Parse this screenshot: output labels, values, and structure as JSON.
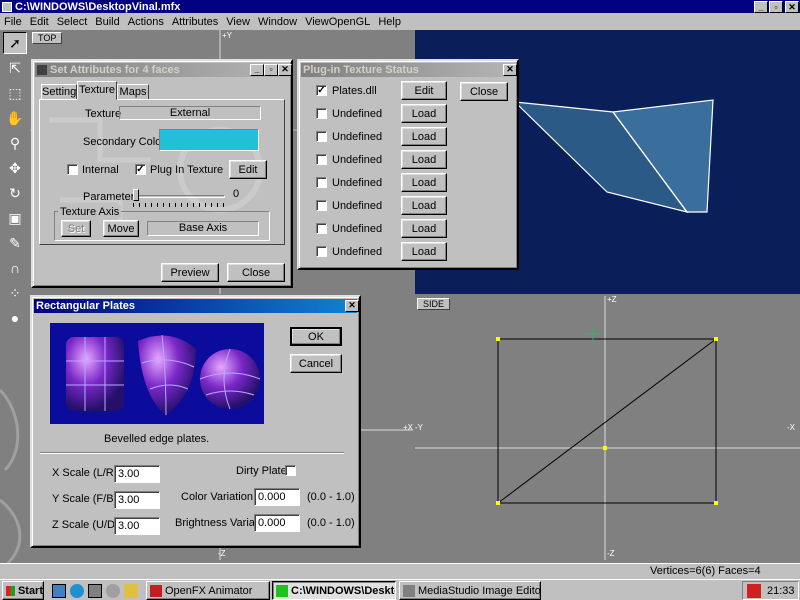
{
  "window": {
    "title": "C:\\WINDOWS\\DesktopVinal.mfx",
    "min": "_",
    "max": "▫",
    "close": "✕"
  },
  "menu": [
    "File",
    "Edit",
    "Select",
    "Build",
    "Actions",
    "Attributes",
    "View",
    "Window",
    "ViewOpenGL",
    "Help"
  ],
  "viewports": {
    "top_label": "TOP",
    "side_label": "SIDE",
    "axis_y": "+Y",
    "axis_z": "+Z",
    "axis_minus_z": "-Z",
    "axis_x_left": "+X",
    "axis_minus_y": "-Y",
    "axis_x_right": "-X",
    "bg_color": "#808080",
    "persp_bg": "#0a1e5a"
  },
  "set_attributes": {
    "title": "Set Attributes for 4 faces",
    "tabs": [
      "Settings",
      "Texture",
      "Maps"
    ],
    "texture_label": "Texture",
    "texture_value": "External",
    "secondary_colour_label": "Secondary Colour",
    "secondary_colour": "#22c0d8",
    "internal_label": "Internal",
    "internal_checked": false,
    "plugin_label": "Plug In Texture",
    "plugin_checked": true,
    "edit_label": "Edit",
    "parameter_label": "Parameter",
    "parameter_value": "0",
    "axis_group": "Texture Axis",
    "set_label": "Set",
    "move_label": "Move",
    "base_axis_label": "Base Axis",
    "preview_label": "Preview",
    "close_label": "Close"
  },
  "plugin_status": {
    "title": "Plug-in Texture Status",
    "close_label": "Close",
    "rows": [
      {
        "name": "Plates.dll",
        "checked": true,
        "button": "Edit"
      },
      {
        "name": "Undefined",
        "checked": false,
        "button": "Load"
      },
      {
        "name": "Undefined",
        "checked": false,
        "button": "Load"
      },
      {
        "name": "Undefined",
        "checked": false,
        "button": "Load"
      },
      {
        "name": "Undefined",
        "checked": false,
        "button": "Load"
      },
      {
        "name": "Undefined",
        "checked": false,
        "button": "Load"
      },
      {
        "name": "Undefined",
        "checked": false,
        "button": "Load"
      },
      {
        "name": "Undefined",
        "checked": false,
        "button": "Load"
      }
    ]
  },
  "plates": {
    "title": "Rectangular Plates",
    "ok_label": "OK",
    "cancel_label": "Cancel",
    "caption": "Bevelled edge plates.",
    "x_label": "X Scale (L/R)",
    "x_value": "3.00",
    "y_label": "Y Scale (F/B)",
    "y_value": "3.00",
    "z_label": "Z Scale (U/D)",
    "z_value": "3.00",
    "dirty_label": "Dirty Plates",
    "color_var_label": "Color Variation",
    "color_var_value": "0.000",
    "color_range": "(0.0 - 1.0)",
    "bright_var_label": "Brightness Variation",
    "bright_var_value": "0.000",
    "bright_range": "(0.0 - 1.0)"
  },
  "status": {
    "text": "Vertices=6(6) Faces=4"
  },
  "taskbar": {
    "start": "Start",
    "tasks": [
      {
        "label": "OpenFX Animator",
        "pressed": false
      },
      {
        "label": "C:\\WINDOWS\\Desktop\\fi...",
        "pressed": true
      },
      {
        "label": "MediaStudio Image Editor",
        "pressed": false
      }
    ],
    "clock": "21:33"
  },
  "tools": [
    "pointer-icon",
    "select-arrow-icon",
    "lasso-icon",
    "hand-icon",
    "zoom-icon",
    "move-icon",
    "rotate-icon",
    "frame-icon",
    "pen-icon",
    "magnet-icon",
    "nodes-icon",
    "sphere-icon"
  ]
}
